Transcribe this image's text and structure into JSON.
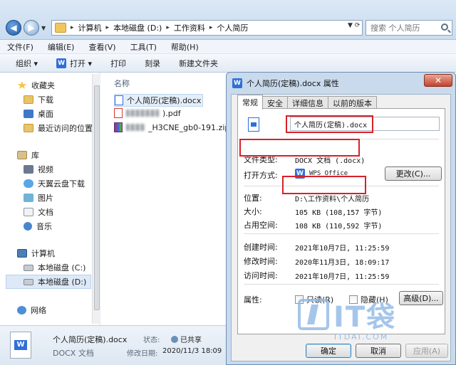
{
  "explorer": {
    "breadcrumb": [
      "计算机",
      "本地磁盘 (D:)",
      "工作资料",
      "个人简历"
    ],
    "search_placeholder": "搜索 个人简历",
    "menu": [
      "文件(F)",
      "编辑(E)",
      "查看(V)",
      "工具(T)",
      "帮助(H)"
    ],
    "toolbar": {
      "organize": "组织 ▾",
      "open": "打开 ▾",
      "print": "打印",
      "burn": "刻录",
      "new_folder": "新建文件夹"
    },
    "nav": {
      "favorites": "收藏夹",
      "downloads": "下载",
      "desktop": "桌面",
      "recent": "最近访问的位置",
      "libraries": "库",
      "videos": "视频",
      "cloud_download": "天翼云盘下载",
      "pictures": "图片",
      "documents": "文档",
      "music": "音乐",
      "computer": "计算机",
      "disk_c": "本地磁盘 (C:)",
      "disk_d": "本地磁盘 (D:)",
      "network": "网络"
    },
    "column_name": "名称",
    "files": [
      {
        "name": "个人简历(定稿).docx"
      },
      {
        "name_suffix": ").pdf"
      },
      {
        "name_suffix": "_H3CNE_gb0-191.zip"
      }
    ],
    "details": {
      "name": "个人简历(定稿).docx",
      "type": "DOCX 文档",
      "state_label": "状态:",
      "state_value": "已共享",
      "modified_label": "修改日期:",
      "modified_value": "2020/11/3 18:09"
    }
  },
  "dialog": {
    "title": "个人简历(定稿).docx 属性",
    "tabs": [
      "常规",
      "安全",
      "详细信息",
      "以前的版本"
    ],
    "filename": "个人简历(定稿).docx",
    "type_label": "文件类型:",
    "type_value": "DOCX 文档 (.docx)",
    "open_with_label": "打开方式:",
    "open_with_value": "WPS Office",
    "change_button": "更改(C)...",
    "location_label": "位置:",
    "location_value": "D:\\工作资料\\个人简历",
    "size_label": "大小:",
    "size_value": "105 KB (108,157 字节)",
    "disk_size_label": "占用空间:",
    "disk_size_value": "108 KB (110,592 字节)",
    "created_label": "创建时间:",
    "created_value": "2021年10月7日, 11:25:59",
    "modified_label": "修改时间:",
    "modified_value": "2020年11月3日, 18:09:17",
    "accessed_label": "访问时间:",
    "accessed_value": "2021年10月7日, 11:25:59",
    "attributes_label": "属性:",
    "readonly_label": "只读(R)",
    "hidden_label": "隐藏(H)",
    "advanced_button": "高级(D)...",
    "ok_button": "确定",
    "cancel_button": "取消",
    "apply_button": "应用(A)"
  },
  "watermark": {
    "brand": "IT袋",
    "site": "ITDAI.COM"
  },
  "colors": {
    "highlight": "#d8202a",
    "accent": "#2f6fd8"
  }
}
